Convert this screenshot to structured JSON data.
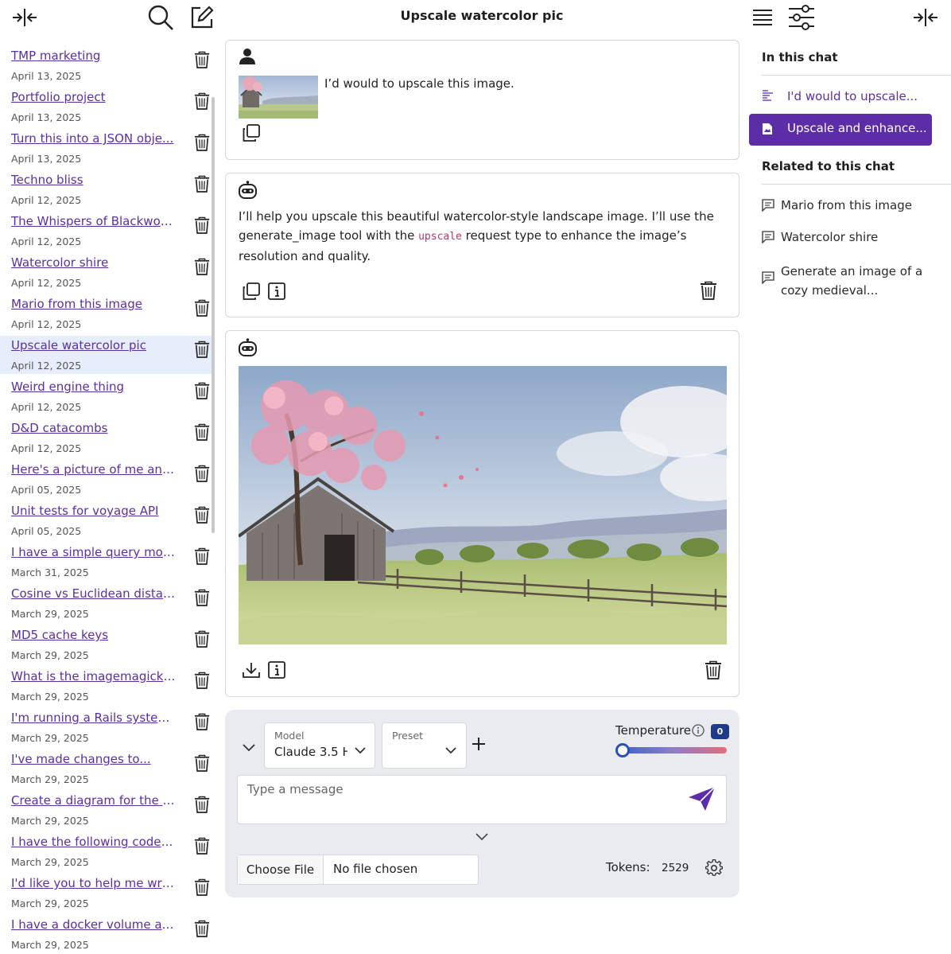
{
  "header": {
    "title": "Upscale watercolor pic"
  },
  "sidebar": {
    "conversations": [
      {
        "title": "TMP marketing",
        "date": "April 13, 2025"
      },
      {
        "title": "Portfolio project",
        "date": "April 13, 2025"
      },
      {
        "title": "Turn this into a JSON obje...",
        "date": "April 13, 2025"
      },
      {
        "title": "Techno bliss",
        "date": "April 12, 2025"
      },
      {
        "title": "The Whispers of Blackwoo...",
        "date": "April 12, 2025"
      },
      {
        "title": "Watercolor shire",
        "date": "April 12, 2025"
      },
      {
        "title": "Mario from this image",
        "date": "April 12, 2025"
      },
      {
        "title": "Upscale watercolor pic",
        "date": "April 12, 2025",
        "active": true
      },
      {
        "title": "Weird engine thing",
        "date": "April 12, 2025"
      },
      {
        "title": "D&D catacombs",
        "date": "April 12, 2025"
      },
      {
        "title": "Here's a picture of me and...",
        "date": "April 05, 2025"
      },
      {
        "title": "Unit tests for voyage API",
        "date": "April 05, 2025"
      },
      {
        "title": "I have a simple query mod...",
        "date": "March 31, 2025"
      },
      {
        "title": "Cosine vs Euclidean distan...",
        "date": "March 29, 2025"
      },
      {
        "title": "MD5 cache keys",
        "date": "March 29, 2025"
      },
      {
        "title": "What is the imagemagick ...",
        "date": "March 29, 2025"
      },
      {
        "title": "I'm running a Rails system...",
        "date": "March 29, 2025"
      },
      {
        "title": "I've made changes to...",
        "date": "March 29, 2025"
      },
      {
        "title": "Create a diagram for the p...",
        "date": "March 29, 2025"
      },
      {
        "title": "I have the following code f...",
        "date": "March 29, 2025"
      },
      {
        "title": "I'd like you to help me writ...",
        "date": "March 29, 2025"
      },
      {
        "title": "I have a docker volume at...",
        "date": "March 29, 2025"
      }
    ]
  },
  "messages": {
    "user": {
      "text": "I’d would to upscale this image."
    },
    "assistant": {
      "text_before": "I’ll help you upscale this beautiful watercolor-style landscape image. I’ll use the generate_image tool with the ",
      "code": "upscale",
      "text_after": " request type to enhance the image’s resolution and quality."
    }
  },
  "composer": {
    "model_label": "Model",
    "model_value": "Claude 3.5 H",
    "preset_label": "Preset",
    "preset_value": "",
    "temperature_label": "Temperature",
    "temperature_value": "0",
    "temperature_level": 0,
    "message_placeholder": "Type a message",
    "choose_file_label": "Choose File",
    "no_file_label": "No file chosen",
    "tokens_label": "Tokens:",
    "tokens_value": "2529"
  },
  "right_panel": {
    "in_this_chat_heading": "In this chat",
    "in_this_chat": [
      {
        "label": "I'd would to upscale..."
      },
      {
        "label": "Upscale and enhance...",
        "active": true
      }
    ],
    "related_heading": "Related to this chat",
    "related": [
      {
        "label": "Mario from this image"
      },
      {
        "label": "Watercolor shire"
      },
      {
        "label": "Generate an image of a",
        "label2": "cozy medieval..."
      }
    ]
  },
  "colors": {
    "accent": "#5b2ea8",
    "active_row": "#e7eefb",
    "composer_bg": "#e9ebee",
    "badge": "#1e3a8a"
  }
}
